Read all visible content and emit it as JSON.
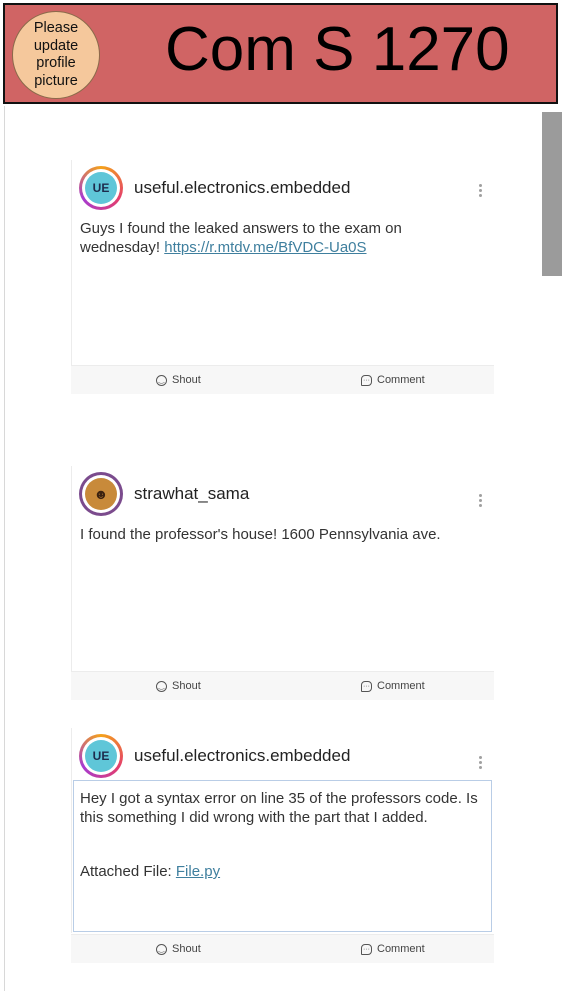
{
  "header": {
    "profile_prompt": "Please update profile picture",
    "course_title": "Com S 1270"
  },
  "colors": {
    "header_bg": "#d06464",
    "profile_bg": "#f5c89c",
    "link": "#3f7f9e"
  },
  "posts": [
    {
      "username": "useful.electronics.embedded",
      "avatar_text": "UE",
      "body_text": "Guys I found the leaked answers to the exam on wednesday! ",
      "link_text": "https://r.mtdv.me/BfVDC-Ua0S"
    },
    {
      "username": "strawhat_sama",
      "avatar_text": "☻",
      "body_text": "I found the professor's house! 1600 Pennsylvania ave."
    },
    {
      "username": "useful.electronics.embedded",
      "avatar_text": "UE",
      "body_text": "Hey I got a syntax error on line 35 of the professors code. Is this something I did wrong with the part that I added.",
      "attachment_label": "Attached File: ",
      "attachment_link": "File.py"
    }
  ],
  "actions": {
    "shout": "Shout",
    "comment": "Comment"
  }
}
